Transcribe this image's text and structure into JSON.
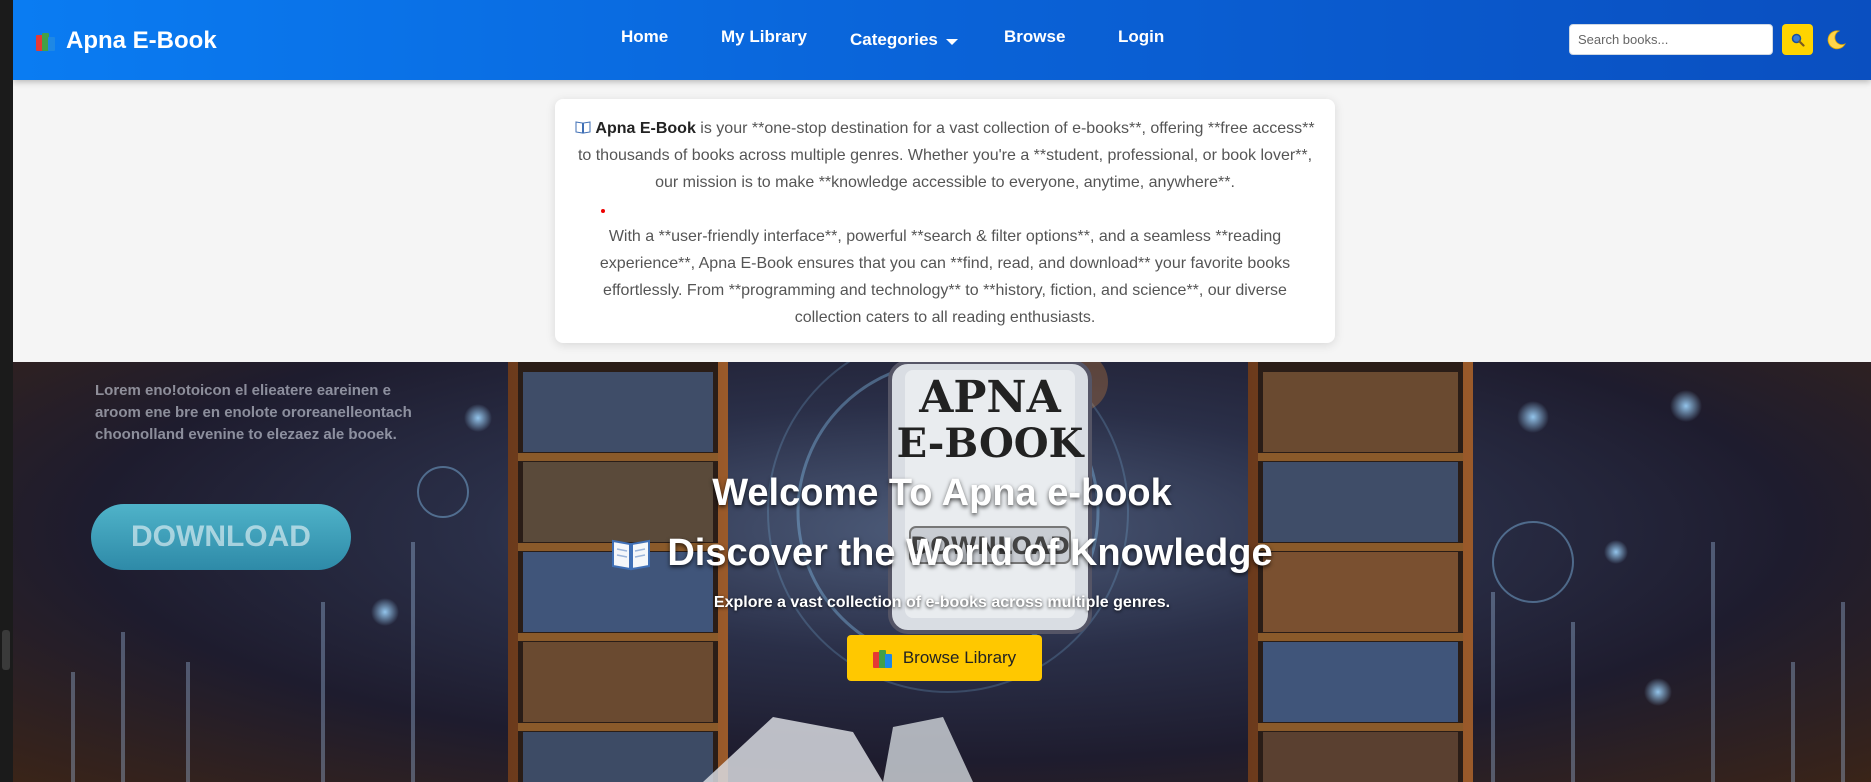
{
  "brand": {
    "name": "Apna E-Book",
    "icon": "books-icon"
  },
  "nav": {
    "home": "Home",
    "library": "My Library",
    "categories": "Categories",
    "browse": "Browse",
    "login": "Login"
  },
  "search": {
    "placeholder": "Search books...",
    "button_icon": "search-icon"
  },
  "theme_toggle_icon": "moon-icon",
  "about": {
    "brand_bold": "Apna E-Book",
    "p1_rest": " is your **one-stop destination for a vast collection of e-books**, offering **free access** to thousands of books across multiple genres. Whether you're a **student, professional, or book lover**, our mission is to make **knowledge accessible to everyone, anytime, anywhere**.",
    "p2": "With a **user-friendly interface**, powerful **search & filter options**, and a seamless **reading experience**, Apna E-Book ensures that you can **find, read, and download** your favorite books effortlessly. From **programming and technology** to **history, fiction, and science**, our diverse collection caters to all reading enthusiasts."
  },
  "hero": {
    "title": "Welcome To Apna e-book",
    "headline": "Discover the World of Knowledge",
    "subtitle": "Explore a vast collection of e-books across multiple genres.",
    "cta": "Browse Library",
    "image_text": {
      "device_title_1": "APNA",
      "device_title_2": "E-BOOK",
      "device_button": "DOWNLOAD",
      "lorem": "Lorem eno!otoicon el elieatere eareinen e aroom ene bre en enolote ororeanelleontach choonolland evenine to elezaez ale booek.",
      "download": "DOWNLOAD"
    }
  },
  "colors": {
    "navbar_start": "#0a7cf2",
    "navbar_end": "#0a4fc0",
    "accent_yellow": "#ffc800",
    "search_button": "#ffd400"
  }
}
